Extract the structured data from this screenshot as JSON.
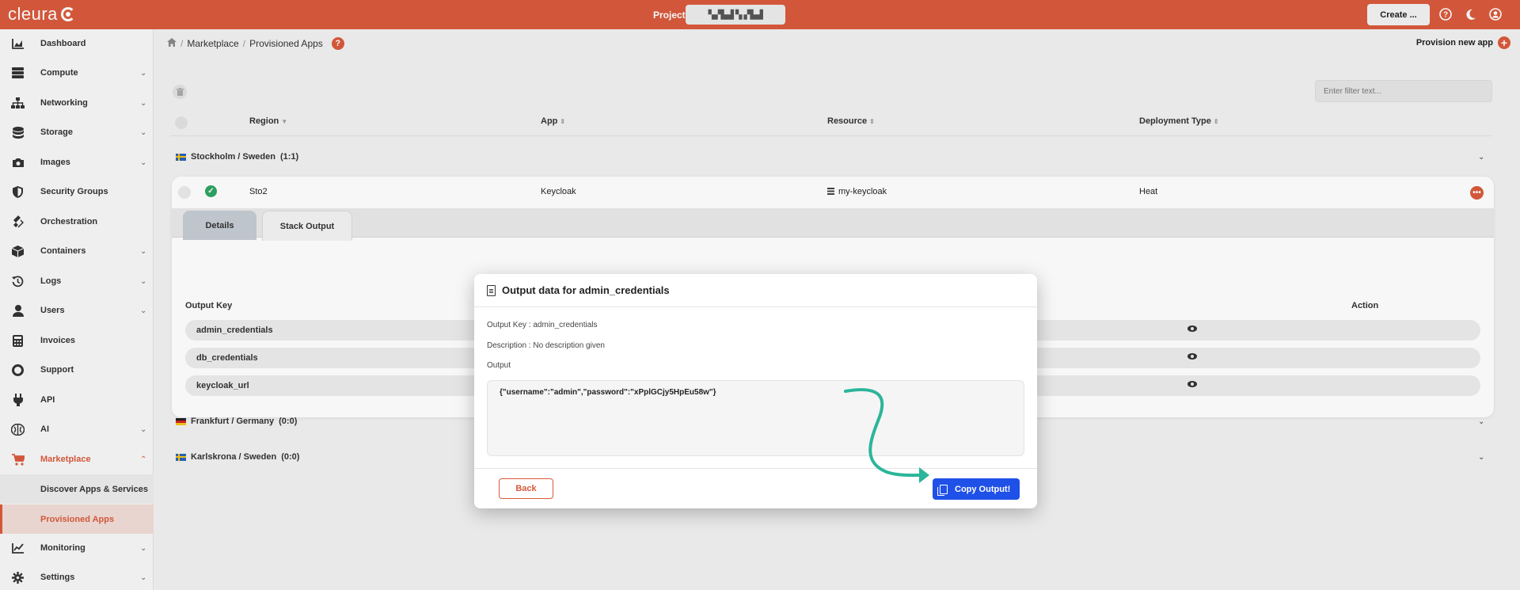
{
  "topbar": {
    "brand": "cleura",
    "project_label": "Project",
    "project_value": "▚▞▙▟ ▚ ▞▙▟",
    "create_label": "Create ..."
  },
  "sidebar": {
    "items": [
      {
        "label": "Dashboard",
        "icon": "chart-area-icon"
      },
      {
        "label": "Compute",
        "icon": "server-icon"
      },
      {
        "label": "Networking",
        "icon": "network-icon"
      },
      {
        "label": "Storage",
        "icon": "database-icon"
      },
      {
        "label": "Images",
        "icon": "camera-icon"
      },
      {
        "label": "Security Groups",
        "icon": "shield-icon"
      },
      {
        "label": "Orchestration",
        "icon": "layers-icon"
      },
      {
        "label": "Containers",
        "icon": "cube-icon"
      },
      {
        "label": "Logs",
        "icon": "history-icon"
      },
      {
        "label": "Users",
        "icon": "user-icon"
      },
      {
        "label": "Invoices",
        "icon": "calculator-icon"
      },
      {
        "label": "Support",
        "icon": "lifebuoy-icon"
      },
      {
        "label": "API",
        "icon": "plug-icon"
      },
      {
        "label": "AI",
        "icon": "brain-icon"
      },
      {
        "label": "Marketplace",
        "icon": "cart-icon"
      },
      {
        "label": "Monitoring",
        "icon": "chart-line-icon"
      },
      {
        "label": "Settings",
        "icon": "gear-icon"
      }
    ],
    "marketplace_sub": [
      {
        "label": "Discover Apps & Services"
      },
      {
        "label": "Provisioned Apps"
      }
    ]
  },
  "breadcrumb": {
    "marketplace": "Marketplace",
    "current": "Provisioned Apps",
    "help": "?"
  },
  "header": {
    "provision_label": "Provision new app"
  },
  "filter": {
    "placeholder": "Enter filter text..."
  },
  "table": {
    "columns": {
      "region": "Region",
      "app": "App",
      "resource": "Resource",
      "deployment": "Deployment Type"
    },
    "groups": [
      {
        "label": "Stockholm / Sweden",
        "count": "(1:1)"
      },
      {
        "label": "Frankfurt / Germany",
        "count": "(0:0)"
      },
      {
        "label": "Karlskrona / Sweden",
        "count": "(0:0)"
      }
    ],
    "row": {
      "region": "Sto2",
      "app": "Keycloak",
      "resource": "my-keycloak",
      "deployment": "Heat"
    },
    "tabs": {
      "details": "Details",
      "stack_output": "Stack Output"
    },
    "output_columns": {
      "key": "Output Key",
      "action": "Action"
    },
    "outputs": [
      {
        "key": "admin_credentials"
      },
      {
        "key": "db_credentials"
      },
      {
        "key": "keycloak_url"
      }
    ]
  },
  "modal": {
    "title": "Output data for admin_credentials",
    "output_key_label": "Output Key : admin_credentials",
    "description_label": "Description : No description given",
    "output_label": "Output",
    "output_value": "{\"username\":\"admin\",\"password\":\"xPplGCjy5HpEu58w\"}",
    "back_label": "Back",
    "copy_label": "Copy Output!"
  },
  "colors": {
    "brand": "#d95a3c",
    "primary": "#1f50e8",
    "success": "#2fa565",
    "annotation_arrow": "#2bb59a"
  }
}
